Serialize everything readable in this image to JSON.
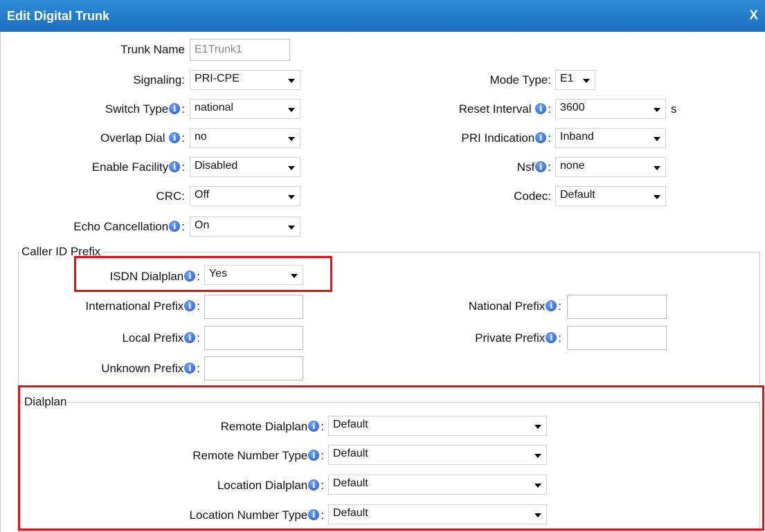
{
  "window": {
    "title": "Edit Digital Trunk",
    "close_label": "X"
  },
  "general": {
    "trunk_name": {
      "label": "Trunk Name",
      "value": "E1Trunk1"
    },
    "signaling": {
      "label": "Signaling:",
      "value": "PRI-CPE"
    },
    "mode_type": {
      "label": "Mode Type:",
      "value": "E1"
    },
    "switch_type": {
      "label": "Switch Type",
      "value": "national"
    },
    "reset_interval": {
      "label": "Reset Interval",
      "value": "3600",
      "unit": "s"
    },
    "overlap_dial": {
      "label": "Overlap Dial",
      "value": "no"
    },
    "pri_indication": {
      "label": "PRI Indication",
      "value": "Inband"
    },
    "enable_facility": {
      "label": "Enable Facility",
      "value": "Disabled"
    },
    "nsf": {
      "label": "Nsf",
      "value": "none"
    },
    "crc": {
      "label": "CRC:",
      "value": "Off"
    },
    "codec": {
      "label": "Codec:",
      "value": "Default"
    },
    "echo_cancellation": {
      "label": "Echo Cancellation",
      "value": "On"
    }
  },
  "caller_id_prefix": {
    "legend": "Caller ID Prefix",
    "isdn_dialplan": {
      "label": "ISDN Dialplan",
      "value": "Yes"
    },
    "international_prefix": {
      "label": "International Prefix",
      "value": ""
    },
    "national_prefix": {
      "label": "National Prefix",
      "value": ""
    },
    "local_prefix": {
      "label": "Local Prefix",
      "value": ""
    },
    "private_prefix": {
      "label": "Private Prefix",
      "value": ""
    },
    "unknown_prefix": {
      "label": "Unknown Prefix",
      "value": ""
    }
  },
  "dialplan": {
    "legend": "Dialplan",
    "remote_dialplan": {
      "label": "Remote Dialplan",
      "value": "Default"
    },
    "remote_number_type": {
      "label": "Remote Number Type",
      "value": "Default"
    },
    "location_dialplan": {
      "label": "Location Dialplan",
      "value": "Default"
    },
    "location_number_type": {
      "label": "Location Number Type",
      "value": "Default"
    }
  },
  "info_icon_glyph": "i",
  "colors": {
    "titlebar": "#1f7acb",
    "highlight": "#e01010",
    "info_icon": "#1f56c9"
  }
}
